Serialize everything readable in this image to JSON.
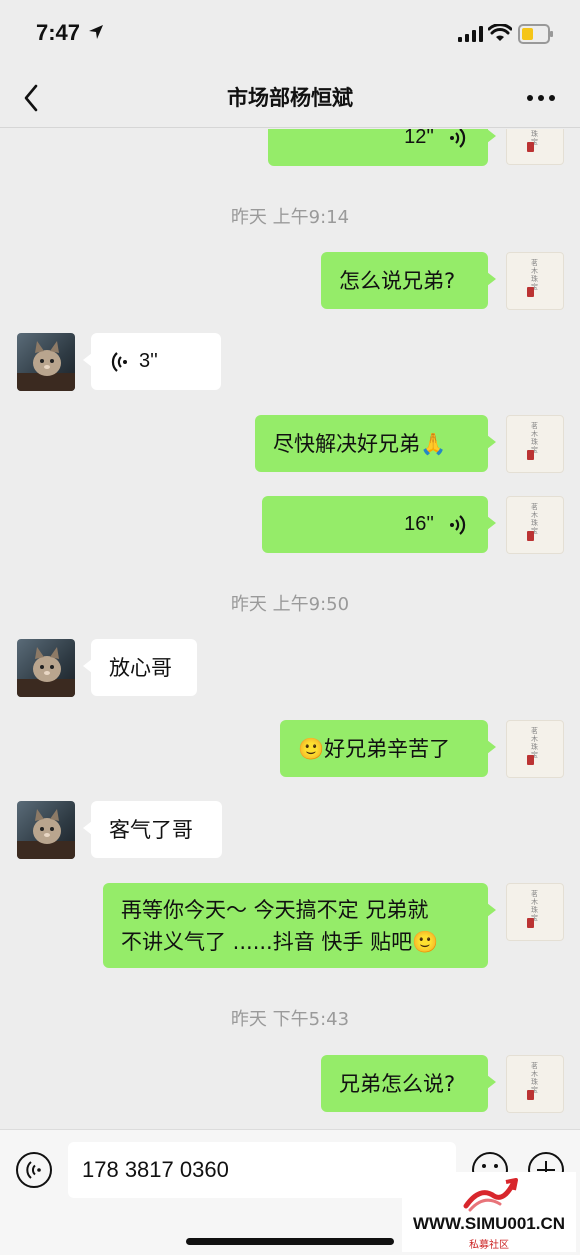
{
  "status_bar": {
    "time": "7:47",
    "icons": [
      "location-arrow-icon",
      "signal-icon",
      "wifi-icon",
      "battery-icon"
    ],
    "battery_color": "#f5c518"
  },
  "nav": {
    "title": "市场部杨恒斌",
    "back_icon": "chevron-left-icon",
    "more_icon": "ellipsis-icon"
  },
  "messages": [
    {
      "kind": "voice",
      "side": "sent",
      "duration": "12''"
    },
    {
      "kind": "timestamp",
      "text": "昨天 上午9:14"
    },
    {
      "kind": "text",
      "side": "sent",
      "text": "怎么说兄弟?"
    },
    {
      "kind": "voice",
      "side": "recv",
      "duration": "3''"
    },
    {
      "kind": "text",
      "side": "sent",
      "text": "尽快解决好兄弟",
      "emoji": "🙏"
    },
    {
      "kind": "voice",
      "side": "sent",
      "duration": "16''"
    },
    {
      "kind": "timestamp",
      "text": "昨天 上午9:50"
    },
    {
      "kind": "text",
      "side": "recv",
      "text": "放心哥"
    },
    {
      "kind": "text",
      "side": "sent",
      "emoji": "🙂",
      "text": "好兄弟辛苦了"
    },
    {
      "kind": "text",
      "side": "recv",
      "text": "客气了哥"
    },
    {
      "kind": "text",
      "side": "sent",
      "lines": [
        "再等你今天～ 今天搞不定 兄弟就",
        "不讲义气了 ......抖音 快手 贴吧"
      ],
      "emoji": "🙂"
    },
    {
      "kind": "timestamp",
      "text": "昨天 下午5:43"
    },
    {
      "kind": "text",
      "side": "sent",
      "text": "兄弟怎么说?"
    }
  ],
  "input_bar": {
    "value": "178 3817 0360",
    "icons": [
      "voice-toggle-icon",
      "emoji-icon",
      "plus-icon"
    ]
  },
  "watermark": {
    "text": "WWW.SIMU001.CN",
    "sub": "私募社区"
  },
  "colors": {
    "sent_bubble": "#95ec69",
    "recv_bubble": "#ffffff",
    "background": "#ededed"
  }
}
